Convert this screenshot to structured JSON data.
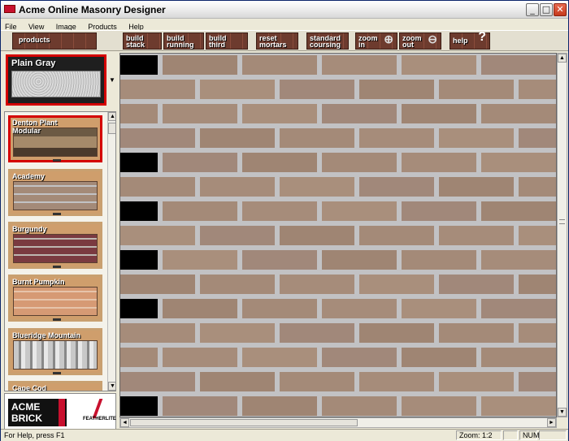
{
  "window": {
    "title": "Acme Online Masonry Designer",
    "minimize": "_",
    "maximize": "□",
    "close": "✕"
  },
  "menu": [
    "File",
    "View",
    "Image",
    "Products",
    "Help"
  ],
  "toolbar": {
    "products": "products",
    "build_stack": [
      "build",
      "stack"
    ],
    "build_running": [
      "build",
      "running"
    ],
    "build_third": [
      "build",
      "third"
    ],
    "reset_mortars": [
      "reset",
      "mortars"
    ],
    "standard_coursing": [
      "standard",
      "coursing"
    ],
    "zoom_in": [
      "zoom",
      "in"
    ],
    "zoom_out": [
      "zoom",
      "out"
    ],
    "help": "help",
    "help_glyph": "?",
    "zoom_in_glyph": "⊕",
    "zoom_out_glyph": "⊖"
  },
  "mortar": {
    "label": "Plain Gray",
    "dropdown": "▼"
  },
  "products": [
    {
      "name": "Denton Plant Modular",
      "selected": true
    },
    {
      "name": "Academy",
      "selected": false
    },
    {
      "name": "Burgundy",
      "selected": false
    },
    {
      "name": "Burnt Pumpkin",
      "selected": false
    },
    {
      "name": "Blueridge Mountain",
      "selected": false
    },
    {
      "name": "Cape Cod",
      "selected": false
    }
  ],
  "logos": {
    "acme_line1": "ACME",
    "acme_line2": "BRICK",
    "featherlite": "FEATHERLITE"
  },
  "status": {
    "help": "For Help, press F1",
    "zoom": "Zoom: 1:2",
    "num": "NUM"
  },
  "colors": {
    "brick": "#a48a78",
    "mortar": "#c2c2c4",
    "accent": "#d40000"
  },
  "scroll": {
    "up": "▲",
    "down": "▼",
    "left": "◄",
    "right": "►"
  }
}
